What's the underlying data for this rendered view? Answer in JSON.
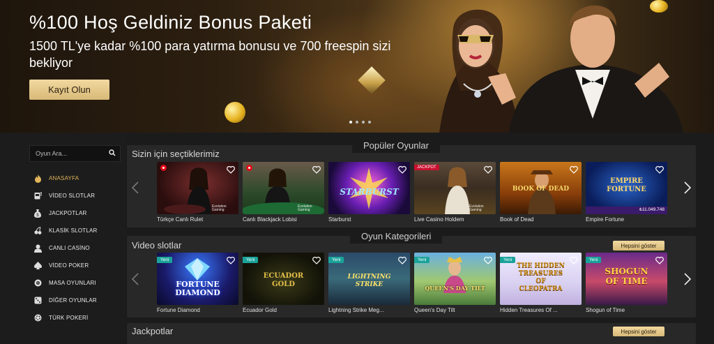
{
  "hero": {
    "title": "%100 Hoş Geldiniz Bonus Paketi",
    "subtitle": "1500 TL'ye kadar %100 para yatırma bonusu ve 700 freespin sizi bekliyor",
    "cta": "Kayıt Olun",
    "slide_count": 4,
    "active_slide": 1
  },
  "sidebar": {
    "search_placeholder": "Oyun Ara...",
    "items": [
      {
        "label": "ANASAYFA",
        "icon": "flame-icon",
        "active": true
      },
      {
        "label": "VİDEO SLOTLAR",
        "icon": "slot-machine-icon"
      },
      {
        "label": "JACKPOTLAR",
        "icon": "money-bag-icon"
      },
      {
        "label": "KLASİK SLOTLAR",
        "icon": "cherry-icon"
      },
      {
        "label": "CANLI CASİNO",
        "icon": "dealer-icon"
      },
      {
        "label": "VİDEO POKER",
        "icon": "spade-icon"
      },
      {
        "label": "MASA OYUNLARI",
        "icon": "roulette-icon"
      },
      {
        "label": "DİĞER OYUNLAR",
        "icon": "dice-icon"
      },
      {
        "label": "TÜRK POKERİ",
        "icon": "chip-icon"
      }
    ]
  },
  "popular": {
    "heading": "Popüler Oyunlar",
    "section_title": "Sizin için seçtiklerimiz",
    "games": [
      {
        "name": "Türkçe Canlı Rulet",
        "flag": true,
        "provider": "Evolution Gaming"
      },
      {
        "name": "Canlı Blackjack Lobisi",
        "flag": true,
        "provider": "Evolution Gaming"
      },
      {
        "name": "Starburst",
        "art": "STARBURST"
      },
      {
        "name": "Live Casino Holdem",
        "badge": "JACKPOT",
        "provider": "Evolution Gaming"
      },
      {
        "name": "Book of Dead",
        "art": "BOOK OF DEAD"
      },
      {
        "name": "Empire Fortune",
        "art": "EMPIRE FORTUNE",
        "jackpot": "₺11.049.748"
      }
    ]
  },
  "categories": {
    "heading": "Oyun Kategorileri",
    "video_slots": {
      "title": "Video slotlar",
      "show_all": "Hepsini göster",
      "games": [
        {
          "name": "Fortune Diamond",
          "badge": "Yeni",
          "art": "FORTUNE DIAMOND"
        },
        {
          "name": "Ecuador Gold",
          "badge": "Yeni",
          "art": "ECUADOR GOLD"
        },
        {
          "name": "Lightning Strike Meg...",
          "badge": "Yeni",
          "art": "LIGHTNING STRIKE"
        },
        {
          "name": "Queen's Day Tilt",
          "badge": "Yeni",
          "art": "QUEEN'S DAY TILT"
        },
        {
          "name": "Hidden Treasures Of ...",
          "badge": "Yeni",
          "art": "THE HIDDEN TREASURES OF CLEOPATRA"
        },
        {
          "name": "Shogun of Time",
          "badge": "Yeni",
          "art": "SHOGUN OF TIME"
        }
      ]
    },
    "jackpots": {
      "title": "Jackpotlar",
      "show_all": "Hepsini göster"
    }
  },
  "colors": {
    "accent_gold": "#e0b55b",
    "button_gold": "#e6c98a",
    "new_badge": "#1aa39a",
    "jackpot_badge": "#c8102e",
    "flag_red": "#e30a17"
  }
}
